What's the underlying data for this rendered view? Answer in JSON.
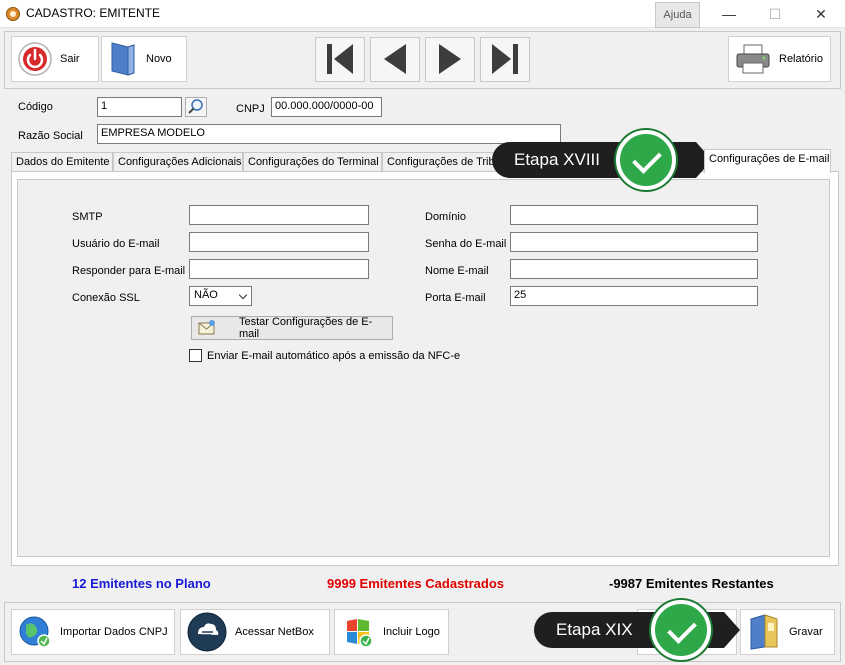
{
  "window": {
    "title": "CADASTRO: EMITENTE",
    "help": "Ajuda",
    "minimize": "—",
    "maximize": "☐",
    "close": "✕"
  },
  "toolbar": {
    "exit": "Sair",
    "new": "Novo",
    "report": "Relatório"
  },
  "header": {
    "code_label": "Código",
    "code_value": "1",
    "cnpj_label": "CNPJ",
    "cnpj_value": "00.000.000/0000-00",
    "company_label": "Razão Social",
    "company_value": "EMPRESA MODELO"
  },
  "tabs": [
    "Dados do Emitente",
    "Configurações Adicionais",
    "Configurações do Terminal",
    "Configurações de Tributação",
    "Configurações de E-mail"
  ],
  "email": {
    "smtp_label": "SMTP",
    "smtp_value": "",
    "user_label": "Usuário do E-mail",
    "user_value": "",
    "reply_label": "Responder para E-mail",
    "reply_value": "",
    "ssl_label": "Conexão SSL",
    "ssl_value": "NÃO",
    "domain_label": "Domínio",
    "domain_value": "",
    "password_label": "Senha do E-mail",
    "password_value": "",
    "name_label": "Nome E-mail",
    "name_value": "",
    "port_label": "Porta E-mail",
    "port_value": "25",
    "test_button": "Testar Configurações de E-mail",
    "auto_send_label": "Enviar E-mail automático após a emissão da NFC-e"
  },
  "status": {
    "plan": "12 Emitentes no Plano",
    "plan_color": "#1a1ad6",
    "registered": "9999 Emitentes Cadastrados",
    "registered_color": "#e00000",
    "remaining": "-9987 Emitentes Restantes",
    "remaining_color": "#000000"
  },
  "bottom": {
    "import": "Importar Dados CNPJ",
    "netbox": "Acessar NetBox",
    "logo": "Incluir Logo",
    "save": "Gravar"
  },
  "callouts": {
    "step18": "Etapa XVIII",
    "step19": "Etapa XIX"
  }
}
